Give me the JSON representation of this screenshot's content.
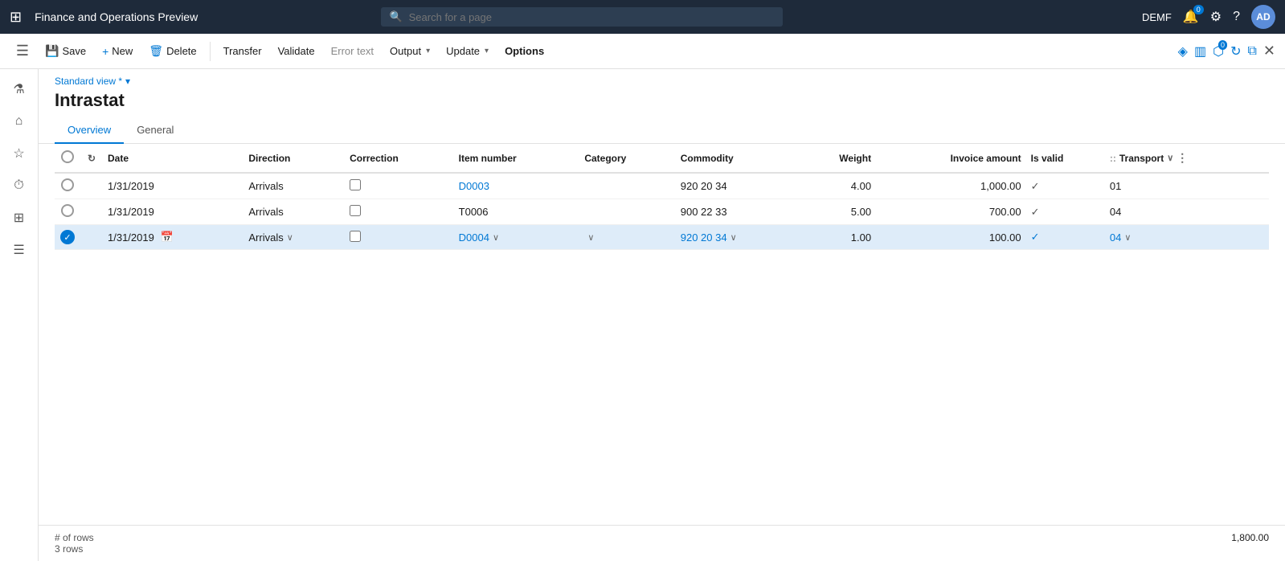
{
  "app": {
    "title": "Finance and Operations Preview",
    "env": "DEMF"
  },
  "search": {
    "placeholder": "Search for a page"
  },
  "toolbar": {
    "save": "Save",
    "new": "New",
    "delete": "Delete",
    "transfer": "Transfer",
    "validate": "Validate",
    "error_text": "Error text",
    "output": "Output",
    "update": "Update",
    "options": "Options"
  },
  "sidebar": {
    "items": [
      {
        "label": "Menu",
        "icon": "≡"
      },
      {
        "label": "Home",
        "icon": "⌂"
      },
      {
        "label": "Favorites",
        "icon": "★"
      },
      {
        "label": "Recent",
        "icon": "⏱"
      },
      {
        "label": "Workspaces",
        "icon": "⊞"
      },
      {
        "label": "List",
        "icon": "☰"
      }
    ]
  },
  "page": {
    "view_label": "Standard view *",
    "title": "Intrastat",
    "tabs": [
      {
        "id": "overview",
        "label": "Overview"
      },
      {
        "id": "general",
        "label": "General"
      }
    ],
    "active_tab": "overview"
  },
  "table": {
    "headers": [
      {
        "id": "select",
        "label": ""
      },
      {
        "id": "refresh",
        "label": ""
      },
      {
        "id": "date",
        "label": "Date"
      },
      {
        "id": "direction",
        "label": "Direction"
      },
      {
        "id": "correction",
        "label": "Correction"
      },
      {
        "id": "item_number",
        "label": "Item number"
      },
      {
        "id": "category",
        "label": "Category"
      },
      {
        "id": "commodity",
        "label": "Commodity"
      },
      {
        "id": "weight",
        "label": "Weight"
      },
      {
        "id": "invoice_amount",
        "label": "Invoice amount"
      },
      {
        "id": "is_valid",
        "label": "Is valid"
      },
      {
        "id": "transport",
        "label": "Transport"
      }
    ],
    "rows": [
      {
        "id": 1,
        "selected": false,
        "date": "1/31/2019",
        "direction": "Arrivals",
        "correction": false,
        "item_number": "D0003",
        "category": "",
        "commodity": "920 20 34",
        "weight": "4.00",
        "invoice_amount": "1,000.00",
        "is_valid": true,
        "transport": "01",
        "editing": false
      },
      {
        "id": 2,
        "selected": false,
        "date": "1/31/2019",
        "direction": "Arrivals",
        "correction": false,
        "item_number": "T0006",
        "category": "",
        "commodity": "900 22 33",
        "weight": "5.00",
        "invoice_amount": "700.00",
        "is_valid": true,
        "transport": "04",
        "editing": false
      },
      {
        "id": 3,
        "selected": true,
        "date": "1/31/2019",
        "direction": "Arrivals",
        "correction": false,
        "item_number": "D0004",
        "category": "",
        "commodity": "920 20 34",
        "weight": "1.00",
        "invoice_amount": "100.00",
        "is_valid": true,
        "transport": "04",
        "editing": true
      }
    ]
  },
  "footer": {
    "rows_label": "# of rows",
    "rows_count": "3 rows",
    "total_amount": "1,800.00"
  },
  "nav_right": {
    "env": "DEMF",
    "avatar": "AD",
    "notif_count": "0"
  }
}
